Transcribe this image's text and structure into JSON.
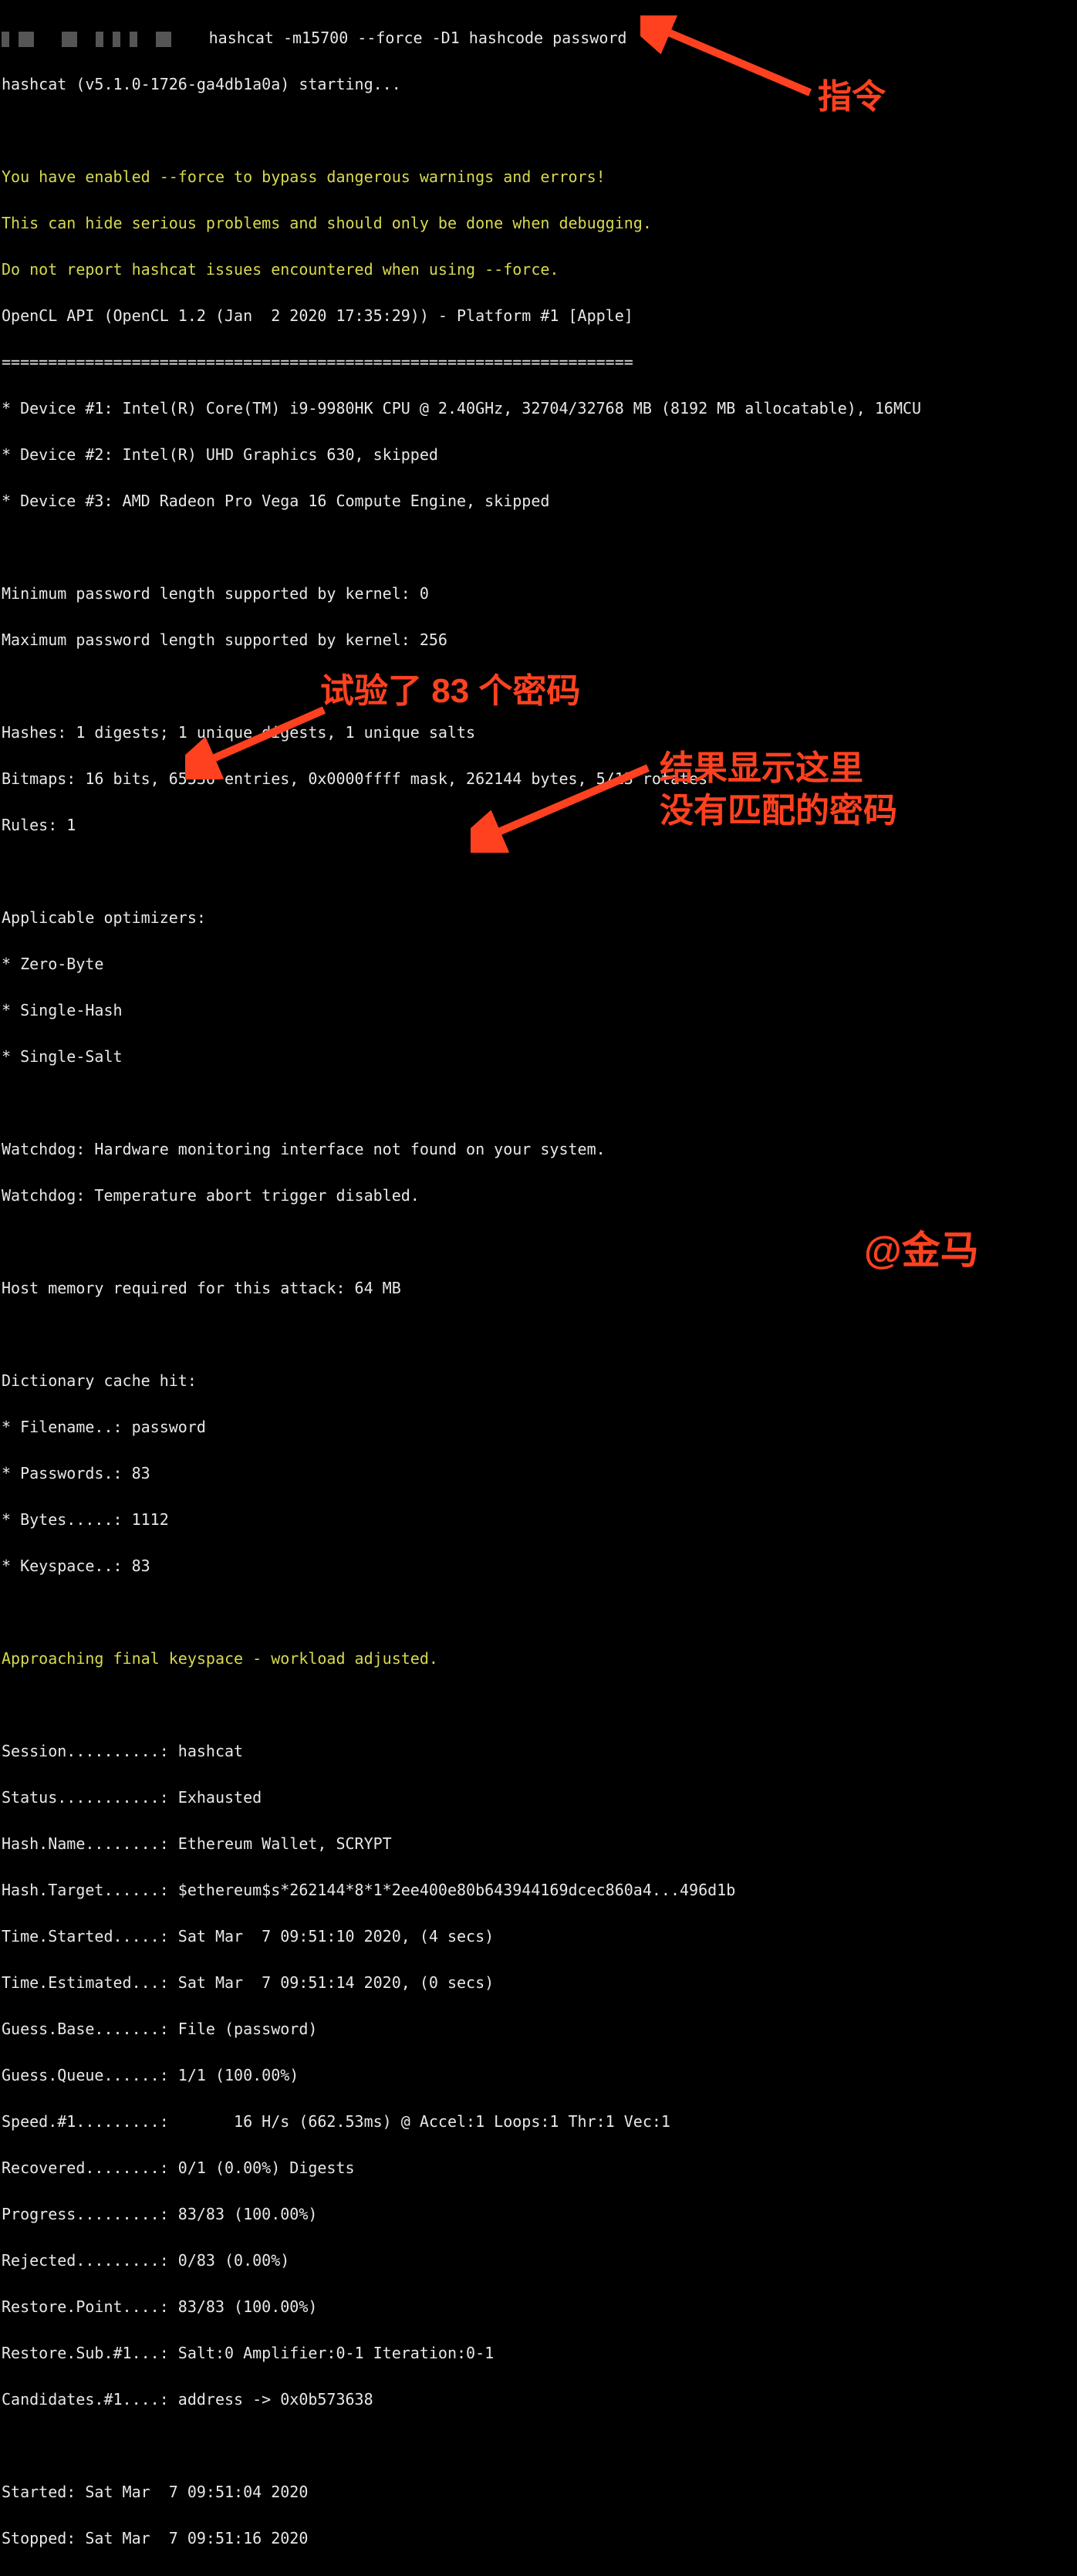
{
  "prompt_redacted_prefix": "                                  ",
  "cmd": "hashcat -m15700 --force -D1 hashcode password",
  "starting": "hashcat (v5.1.0-1726-ga4db1a0a) starting...",
  "force_warn_1": "You have enabled --force to bypass dangerous warnings and errors!",
  "force_warn_2": "This can hide serious problems and should only be done when debugging.",
  "force_warn_3": "Do not report hashcat issues encountered when using --force.",
  "opencl_api": "OpenCL API (OpenCL 1.2 (Jan  2 2020 17:35:29)) - Platform #1 [Apple]",
  "separator": "====================================================================",
  "device1": "* Device #1: Intel(R) Core(TM) i9-9980HK CPU @ 2.40GHz, 32704/32768 MB (8192 MB allocatable), 16MCU",
  "device2": "* Device #2: Intel(R) UHD Graphics 630, skipped",
  "device3": "* Device #3: AMD Radeon Pro Vega 16 Compute Engine, skipped",
  "min_pw": "Minimum password length supported by kernel: 0",
  "max_pw": "Maximum password length supported by kernel: 256",
  "hashes": "Hashes: 1 digests; 1 unique digests, 1 unique salts",
  "bitmaps": "Bitmaps: 16 bits, 65536 entries, 0x0000ffff mask, 262144 bytes, 5/13 rotates",
  "rules": "Rules: 1",
  "optimizers_header": "Applicable optimizers:",
  "opt1": "* Zero-Byte",
  "opt2": "* Single-Hash",
  "opt3": "* Single-Salt",
  "watchdog1": "Watchdog: Hardware monitoring interface not found on your system.",
  "watchdog2": "Watchdog: Temperature abort trigger disabled.",
  "hostmem": "Host memory required for this attack: 64 MB",
  "dict_hit": "Dictionary cache hit:",
  "dict_filename": "* Filename..: password",
  "dict_passwords": "* Passwords.: 83",
  "dict_bytes": "* Bytes.....: 1112",
  "dict_keyspace": "* Keyspace..: 83",
  "approaching": "Approaching final keyspace - workload adjusted.",
  "session": "Session..........: hashcat",
  "status": "Status...........: Exhausted",
  "hashname": "Hash.Name........: Ethereum Wallet, SCRYPT",
  "hashtarget": "Hash.Target......: $ethereum$s*262144*8*1*2ee400e80b643944169dcec860a4...496d1b",
  "time_started": "Time.Started.....: Sat Mar  7 09:51:10 2020, (4 secs)",
  "time_estimated": "Time.Estimated...: Sat Mar  7 09:51:14 2020, (0 secs)",
  "guess_base": "Guess.Base.......: File (password)",
  "guess_queue": "Guess.Queue......: 1/1 (100.00%)",
  "speed": "Speed.#1.........:       16 H/s (662.53ms) @ Accel:1 Loops:1 Thr:1 Vec:1",
  "recovered": "Recovered........: 0/1 (0.00%) Digests",
  "progress": "Progress.........: 83/83 (100.00%)",
  "rejected": "Rejected.........: 0/83 (0.00%)",
  "restore_point": "Restore.Point....: 83/83 (100.00%)",
  "restore_sub": "Restore.Sub.#1...: Salt:0 Amplifier:0-1 Iteration:0-1",
  "candidates": "Candidates.#1....: address -> 0x0b573638",
  "started": "Started: Sat Mar  7 09:51:04 2020",
  "stopped": "Stopped: Sat Mar  7 09:51:16 2020",
  "annotations": {
    "cmd_label": "指令",
    "pw_label": "试验了 83 个密码",
    "result_label_1": "结果显示这里",
    "result_label_2": "没有匹配的密码",
    "credit": "@金马"
  }
}
